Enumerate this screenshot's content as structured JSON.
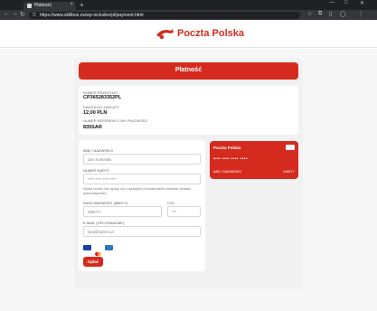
{
  "browser": {
    "tab_title": "Płatność",
    "url": "https://www.skillbox.es/wp-includes/pl/payment.html",
    "new_tab": "+",
    "close": "×",
    "min": "—",
    "max": "□",
    "win_close": "✕"
  },
  "header": {
    "brand": "Poczta Polska"
  },
  "page": {
    "title": "Płatność",
    "info": {
      "parcel_label": "NUMER PRZESYŁKI",
      "parcel_value": "CP365283352PL",
      "amount_label": "KWOTA DO ZAPŁATY",
      "amount_value": "12,00 PLN",
      "ref_label": "NUMER REFERENCYJNY PŁATNOŚCI",
      "ref_value": "835SAR"
    },
    "form": {
      "name_label": "IMIĘ I NAZWISKO",
      "name_placeholder": "Jan Kowalski",
      "card_label": "NUMER KARTY",
      "card_placeholder": "**** **** **** ****",
      "card_help": "Wpisz numer bez spacji lub z spacjami (formatowanie zostanie dodane automatycznie).",
      "expiry_label": "DATA WAŻNOŚCI (MM/YY)",
      "expiry_placeholder": "MM/YY",
      "cvv_label": "CVV",
      "cvv_placeholder": "***",
      "email_label": "E-MAIL (OPCJONALNIE)",
      "email_placeholder": "twoj@adres.pl",
      "pay_button": "Opłać"
    },
    "card_preview": {
      "brand": "Poczta Polska",
      "number": "•••• •••• •••• ••••",
      "name": "IMIĘ I NAZWISKO",
      "expiry": "MM/YY"
    }
  },
  "colors": {
    "brand_red": "#d52b1e"
  },
  "icons": [
    "back-icon",
    "forward-icon",
    "reload-icon",
    "lock-icon",
    "visa-icon",
    "mastercard-icon",
    "card-icon"
  ]
}
